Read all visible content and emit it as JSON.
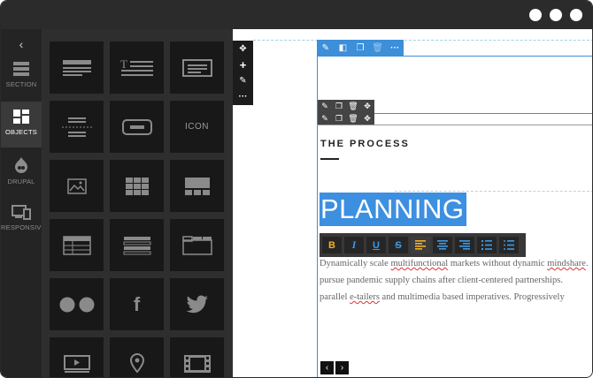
{
  "window": {
    "controls": [
      "dot-1",
      "dot-2",
      "dot-3"
    ]
  },
  "rail": {
    "back_glyph": "‹",
    "items": [
      {
        "label": "SECTION",
        "icon": "section-icon"
      },
      {
        "label": "OBJECTS",
        "icon": "objects-icon"
      },
      {
        "label": "DRUPAL",
        "icon": "drupal-icon"
      },
      {
        "label": "RESPONSIVE",
        "icon": "responsive-icon"
      }
    ]
  },
  "objects": {
    "tiles": [
      {
        "name": "heading-block",
        "text": ""
      },
      {
        "name": "text-block",
        "text": ""
      },
      {
        "name": "text-box-block",
        "text": ""
      },
      {
        "name": "divider-block",
        "text": ""
      },
      {
        "name": "button-block",
        "text": ""
      },
      {
        "name": "icon-block",
        "text": "ICON"
      },
      {
        "name": "image-block",
        "text": ""
      },
      {
        "name": "gallery-block",
        "text": ""
      },
      {
        "name": "slider-block",
        "text": ""
      },
      {
        "name": "table-block",
        "text": ""
      },
      {
        "name": "list-block",
        "text": ""
      },
      {
        "name": "tabs-block",
        "text": ""
      },
      {
        "name": "flickr-block",
        "text": ""
      },
      {
        "name": "facebook-block",
        "text": "f"
      },
      {
        "name": "twitter-block",
        "text": ""
      },
      {
        "name": "video-block",
        "text": ""
      },
      {
        "name": "map-block",
        "text": ""
      },
      {
        "name": "media-block",
        "text": ""
      }
    ]
  },
  "editor": {
    "section_tools": [
      "move",
      "add",
      "edit",
      "more"
    ],
    "row_tools": [
      "edit",
      "columns",
      "copy",
      "delete",
      "more"
    ],
    "column_tools_1": [
      "edit",
      "copy",
      "delete",
      "move"
    ],
    "column_tools_2": [
      "edit",
      "copy",
      "delete",
      "move"
    ]
  },
  "content": {
    "eyebrow": "THE PROCESS",
    "heading": "PLANNING",
    "paragraph_lines": [
      "Dynamically scale multifunctional markets without dynamic mindshare.",
      "pursue pandemic supply chains after client-centered partnerships.",
      "parallel e-tailers and multimedia based imperatives. Progressively"
    ]
  },
  "format_toolbar": {
    "buttons": [
      {
        "name": "bold",
        "label": "B"
      },
      {
        "name": "italic",
        "label": "I"
      },
      {
        "name": "underline",
        "label": "U"
      },
      {
        "name": "strikethrough",
        "label": "S"
      },
      {
        "name": "align-left",
        "label": ""
      },
      {
        "name": "align-center",
        "label": ""
      },
      {
        "name": "align-right",
        "label": ""
      },
      {
        "name": "ordered-list",
        "label": ""
      },
      {
        "name": "unordered-list",
        "label": ""
      }
    ]
  },
  "slider_nav": {
    "prev": "‹",
    "next": "›"
  },
  "colors": {
    "accent_blue": "#3c8fd8",
    "highlight_blue": "#3d8fe0",
    "format_orange": "#f0b129",
    "panel_bg": "#2e2e2e",
    "tile_bg": "#181818"
  }
}
